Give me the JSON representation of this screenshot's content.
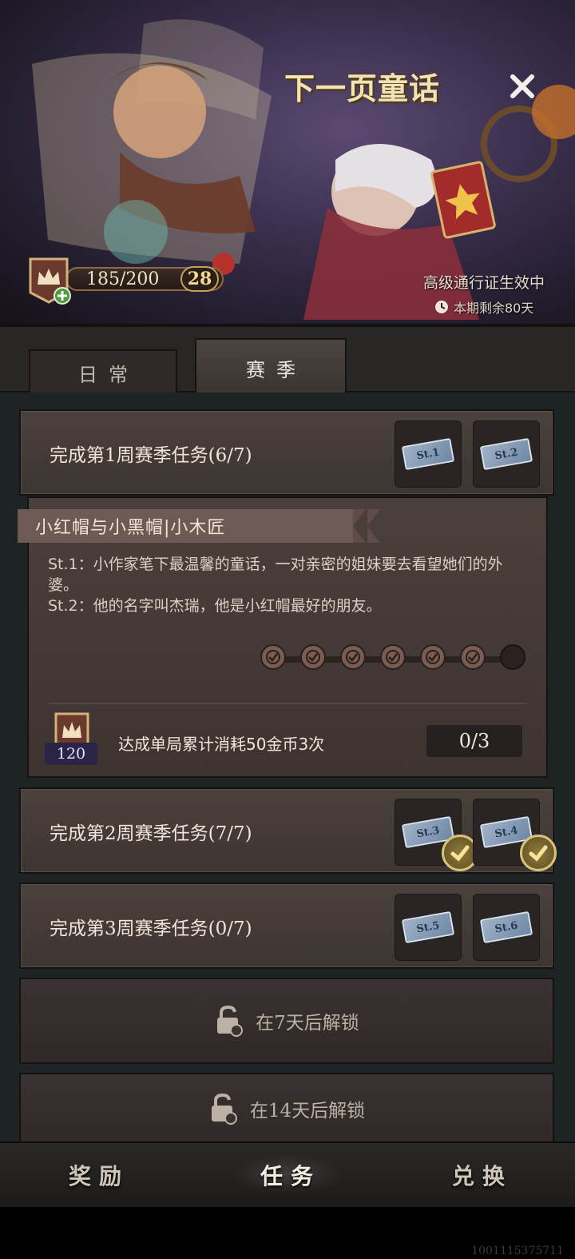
{
  "banner": {
    "title": "下一页童话",
    "exp": "185/200",
    "level": "28",
    "pass_status": "高级通行证生效中",
    "days_left": "本期剩余80天"
  },
  "tabs": [
    {
      "label": "日常",
      "active": false
    },
    {
      "label": "赛季",
      "active": true
    }
  ],
  "weeks": [
    {
      "title_prefix": "完成第",
      "week_num": "1",
      "title_suffix": "周赛季任务",
      "progress": "(6/7)",
      "rewards": [
        "St.1",
        "St.2"
      ],
      "claimed": [
        false,
        false
      ]
    },
    {
      "title_prefix": "完成第",
      "week_num": "2",
      "title_suffix": "周赛季任务",
      "progress": "(7/7)",
      "rewards": [
        "St.3",
        "St.4"
      ],
      "claimed": [
        true,
        true
      ]
    },
    {
      "title_prefix": "完成第",
      "week_num": "3",
      "title_suffix": "周赛季任务",
      "progress": "(0/7)",
      "rewards": [
        "St.5",
        "St.6"
      ],
      "claimed": [
        false,
        false
      ]
    }
  ],
  "detail": {
    "story_title": "小红帽与小黑帽|小木匠",
    "st1_label": "St.1",
    "st1_text": "：小作家笔下最温馨的童话，一对亲密的姐妹要去看望她们的外婆。",
    "st2_label": "St.2",
    "st2_text": "：他的名字叫杰瑞，他是小红帽最好的朋友。",
    "progress_done": 6,
    "progress_total": 7,
    "task_reward": "120",
    "task_desc": "达成单局累计消耗50金币3次",
    "task_progress": "0/3"
  },
  "locked": [
    {
      "text": "在7天后解锁"
    },
    {
      "text": "在14天后解锁"
    }
  ],
  "nav": [
    {
      "label": "奖励",
      "active": false
    },
    {
      "label": "任务",
      "active": true
    },
    {
      "label": "兑换",
      "active": false
    }
  ],
  "footer": {
    "build_id": "1001115375711"
  },
  "colors": {
    "accent_gold": "#d9c27a",
    "card_brown": "#4b413d",
    "bg_dark": "#1e2425"
  }
}
